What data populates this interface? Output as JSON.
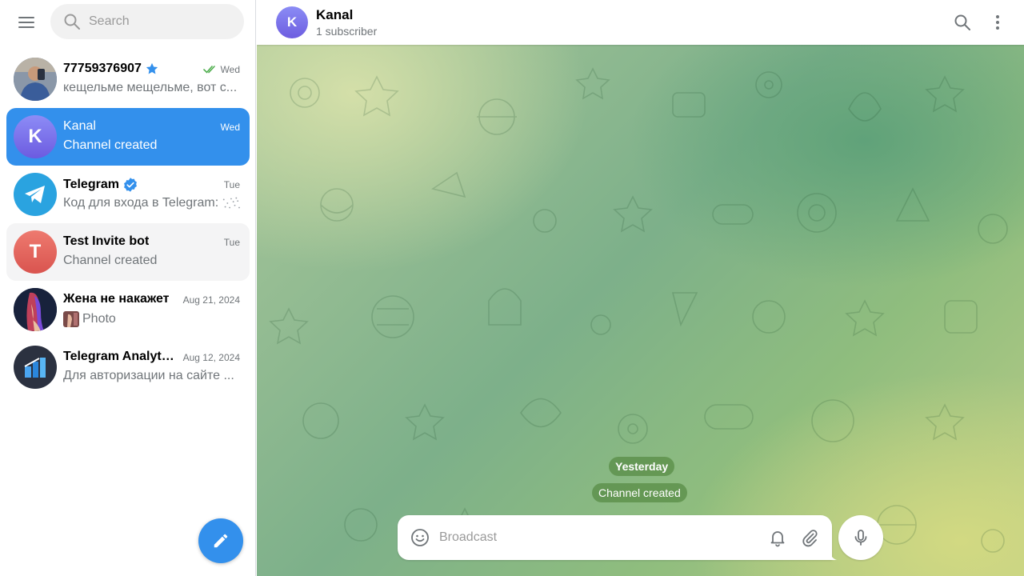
{
  "sidebar": {
    "search": {
      "placeholder": "Search"
    },
    "chats": [
      {
        "title": "77759376907",
        "preview": "кещельме мещельме, вот с...",
        "date": "Wed",
        "read": true,
        "starred": true
      },
      {
        "title": "Kanal",
        "preview": "Channel created",
        "date": "Wed",
        "avatar_letter": "K",
        "active": true
      },
      {
        "title": "Telegram",
        "preview": "Код для входа в Telegram:",
        "date": "Tue",
        "verified": true
      },
      {
        "title": "Test Invite bot",
        "preview": "Channel created",
        "date": "Tue",
        "avatar_letter": "T"
      },
      {
        "title": "Жена не накажет",
        "preview": "Photo",
        "date": "Aug 21, 2024"
      },
      {
        "title": "Telegram Analytics",
        "preview": "Для авторизации на сайте ...",
        "date": "Aug 12, 2024"
      }
    ]
  },
  "chat": {
    "avatar_letter": "K",
    "title": "Kanal",
    "subtitle": "1 subscriber",
    "date_pill": "Yesterday",
    "service_message": "Channel created",
    "composer_placeholder": "Broadcast"
  },
  "colors": {
    "accent": "#3390ec",
    "kanal_avatar": "#7b6ee8",
    "test_bot_avatar": "#e05f5a"
  },
  "icons": [
    "menu-icon",
    "search-icon",
    "star-icon",
    "double-check-icon",
    "verified-icon",
    "telegram-plane-icon",
    "analytics-icon",
    "pencil-icon",
    "more-vertical-icon",
    "emoji-icon",
    "bell-icon",
    "paperclip-icon",
    "microphone-icon"
  ]
}
